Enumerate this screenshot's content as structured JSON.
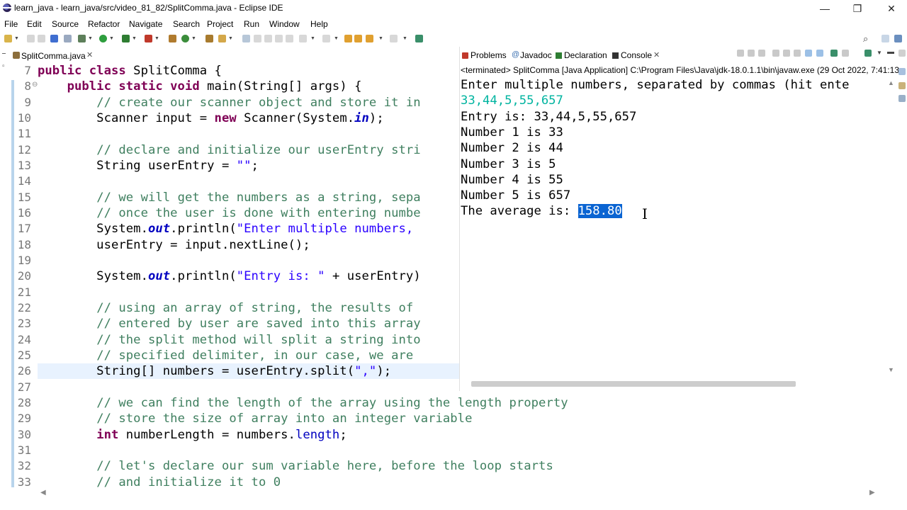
{
  "window": {
    "title": "learn_java - learn_java/src/video_81_82/SplitComma.java - Eclipse IDE",
    "minimize": "—",
    "restore": "❐",
    "close": "✕"
  },
  "menu": [
    "File",
    "Edit",
    "Source",
    "Refactor",
    "Navigate",
    "Search",
    "Project",
    "Run",
    "Window",
    "Help"
  ],
  "editor": {
    "tab_label": "SplitComma.java",
    "tab_close": "✕",
    "lines": [
      {
        "n": "7",
        "marker": "",
        "html": "<span class=\"kw\">public class</span> SplitComma {"
      },
      {
        "n": "8",
        "marker": "⊖",
        "html": "    <span class=\"kw\">public static void</span> main(String[] args) {"
      },
      {
        "n": "9",
        "marker": "",
        "html": "        <span class=\"cm\">// create our scanner object and store it in</span>"
      },
      {
        "n": "10",
        "marker": "",
        "html": "        Scanner input = <span class=\"kw\">new</span> Scanner(System.<span class=\"fld\">in</span>);"
      },
      {
        "n": "11",
        "marker": "",
        "html": ""
      },
      {
        "n": "12",
        "marker": "",
        "html": "        <span class=\"cm\">// declare and initialize our userEntry stri</span>"
      },
      {
        "n": "13",
        "marker": "",
        "html": "        String userEntry = <span class=\"str\">\"\"</span>;"
      },
      {
        "n": "14",
        "marker": "",
        "html": ""
      },
      {
        "n": "15",
        "marker": "",
        "html": "        <span class=\"cm\">// we will get the numbers as a string, sepa</span>"
      },
      {
        "n": "16",
        "marker": "",
        "html": "        <span class=\"cm\">// once the user is done with entering numbe</span>"
      },
      {
        "n": "17",
        "marker": "",
        "html": "        System.<span class=\"fld\">out</span>.println(<span class=\"str\">\"Enter multiple numbers,</span>"
      },
      {
        "n": "18",
        "marker": "",
        "html": "        userEntry = input.nextLine();"
      },
      {
        "n": "19",
        "marker": "",
        "html": ""
      },
      {
        "n": "20",
        "marker": "",
        "html": "        System.<span class=\"fld\">out</span>.println(<span class=\"str\">\"Entry is: \"</span> + userEntry)"
      },
      {
        "n": "21",
        "marker": "",
        "html": ""
      },
      {
        "n": "22",
        "marker": "",
        "html": "        <span class=\"cm\">// using an array of string, the results of</span>"
      },
      {
        "n": "23",
        "marker": "",
        "html": "        <span class=\"cm\">// entered by user are saved into this array</span>"
      },
      {
        "n": "24",
        "marker": "",
        "html": "        <span class=\"cm\">// the split method will split a string into</span>"
      },
      {
        "n": "25",
        "marker": "",
        "html": "        <span class=\"cm\">// specified delimiter, in our case, we are</span>"
      },
      {
        "n": "26",
        "marker": "",
        "html": "        String[] numbers = userEntry.split(<span class=\"str\">\",\"</span>);"
      },
      {
        "n": "27",
        "marker": "",
        "html": ""
      },
      {
        "n": "28",
        "marker": "",
        "html": "        <span class=\"cm\">// we can find the length of the array using the length property</span>"
      },
      {
        "n": "29",
        "marker": "",
        "html": "        <span class=\"cm\">// store the size of array into an integer variable</span>"
      },
      {
        "n": "30",
        "marker": "",
        "html": "        <span class=\"kw\">int</span> numberLength = numbers.<span style=\"color:#0000c0\">length</span>;"
      },
      {
        "n": "31",
        "marker": "",
        "html": ""
      },
      {
        "n": "32",
        "marker": "",
        "html": "        <span class=\"cm\">// let's declare our sum variable here, before the loop starts</span>"
      },
      {
        "n": "33",
        "marker": "",
        "html": "        <span class=\"cm\">// and initialize it to 0</span>"
      }
    ]
  },
  "console": {
    "tabs": [
      {
        "label": "Problems",
        "color": "#c0392b"
      },
      {
        "label": "Javadoc",
        "color": "#3a6fb0"
      },
      {
        "label": "Declaration",
        "color": "#2e7d32"
      },
      {
        "label": "Console",
        "color": "#333333"
      }
    ],
    "tab_close": "✕",
    "status": "<terminated> SplitComma [Java Application] C:\\Program Files\\Java\\jdk-18.0.1.1\\bin\\javaw.exe  (29 Oct 2022, 7:41:13",
    "output": [
      {
        "text": "Enter multiple numbers, separated by commas (hit ente",
        "type": "stdout"
      },
      {
        "text": "33,44,5,55,657",
        "type": "input"
      },
      {
        "text": "Entry is: 33,44,5,55,657",
        "type": "stdout"
      },
      {
        "text": "Number 1 is 33",
        "type": "stdout"
      },
      {
        "text": "Number 2 is 44",
        "type": "stdout"
      },
      {
        "text": "Number 3 is 5",
        "type": "stdout"
      },
      {
        "text": "Number 4 is 55",
        "type": "stdout"
      },
      {
        "text": "Number 5 is 657",
        "type": "stdout"
      }
    ],
    "average_prefix": "The average is: ",
    "average_value": "158.80"
  }
}
